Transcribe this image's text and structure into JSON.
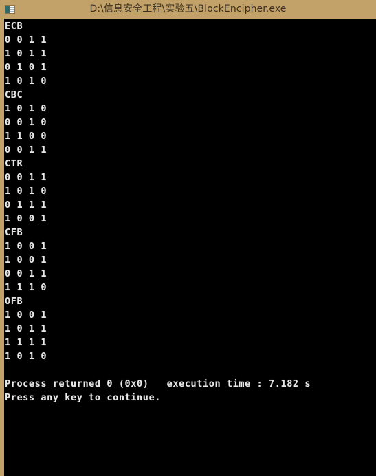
{
  "window": {
    "title": "D:\\信息安全工程\\实验五\\BlockEncipher.exe",
    "icon": "console-app-icon",
    "titlebar_color": "#c2a268",
    "background_color": "#000000",
    "text_color": "#e8e8e8"
  },
  "console": {
    "blocks": [
      {
        "label": "ECB",
        "rows": [
          "0 0 1 1",
          "1 0 1 1",
          "0 1 0 1",
          "1 0 1 0"
        ]
      },
      {
        "label": "CBC",
        "rows": [
          "1 0 1 0",
          "0 0 1 0",
          "1 1 0 0",
          "0 0 1 1"
        ]
      },
      {
        "label": "CTR",
        "rows": [
          "0 0 1 1",
          "1 0 1 0",
          "0 1 1 1",
          "1 0 0 1"
        ]
      },
      {
        "label": "CFB",
        "rows": [
          "1 0 0 1",
          "1 0 0 1",
          "0 0 1 1",
          "1 1 1 0"
        ]
      },
      {
        "label": "OFB",
        "rows": [
          "1 0 0 1",
          "1 0 1 1",
          "1 1 1 1",
          "1 0 1 0"
        ]
      }
    ],
    "status": {
      "process_returned": "Process returned 0 (0x0)",
      "execution_time_label": "execution time :",
      "execution_time_value": "7.182 s",
      "prompt": "Press any key to continue."
    },
    "full_text": "ECB\n0 0 1 1\n1 0 1 1\n0 1 0 1\n1 0 1 0\nCBC\n1 0 1 0\n0 0 1 0\n1 1 0 0\n0 0 1 1\nCTR\n0 0 1 1\n1 0 1 0\n0 1 1 1\n1 0 0 1\nCFB\n1 0 0 1\n1 0 0 1\n0 0 1 1\n1 1 1 0\nOFB\n1 0 0 1\n1 0 1 1\n1 1 1 1\n1 0 1 0\n\nProcess returned 0 (0x0)   execution time : 7.182 s\nPress any key to continue."
  }
}
